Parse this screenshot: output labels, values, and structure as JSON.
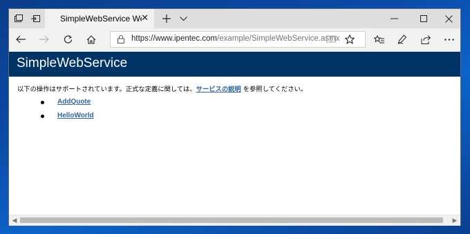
{
  "browser": {
    "tab": {
      "title": "SimpleWebService Web"
    },
    "address": {
      "url_host": "https://www.ipentec.com",
      "url_path": "/example/SimpleWebService.asmx"
    }
  },
  "page": {
    "title": "SimpleWebService",
    "intro_before": "以下の操作はサポートされています。正式な定義に関しては、",
    "intro_link": "サービスの説明",
    "intro_after": " を参照してください。",
    "operations": [
      "AddQuote",
      "HelloWorld"
    ]
  },
  "colors": {
    "header_bg": "#003366",
    "link": "#336699"
  },
  "icons": {
    "tab_bar": [
      "tab-preview-icon",
      "set-aside-tabs-icon",
      "close-icon",
      "new-tab-icon",
      "tab-list-chevron-icon"
    ],
    "window": [
      "minimize-icon",
      "maximize-icon",
      "close-window-icon"
    ],
    "nav": [
      "back-icon",
      "forward-icon",
      "refresh-icon",
      "home-icon",
      "lock-icon",
      "reading-view-icon",
      "favorite-star-icon",
      "favorites-hub-icon",
      "pen-icon",
      "share-icon",
      "more-icon"
    ]
  }
}
